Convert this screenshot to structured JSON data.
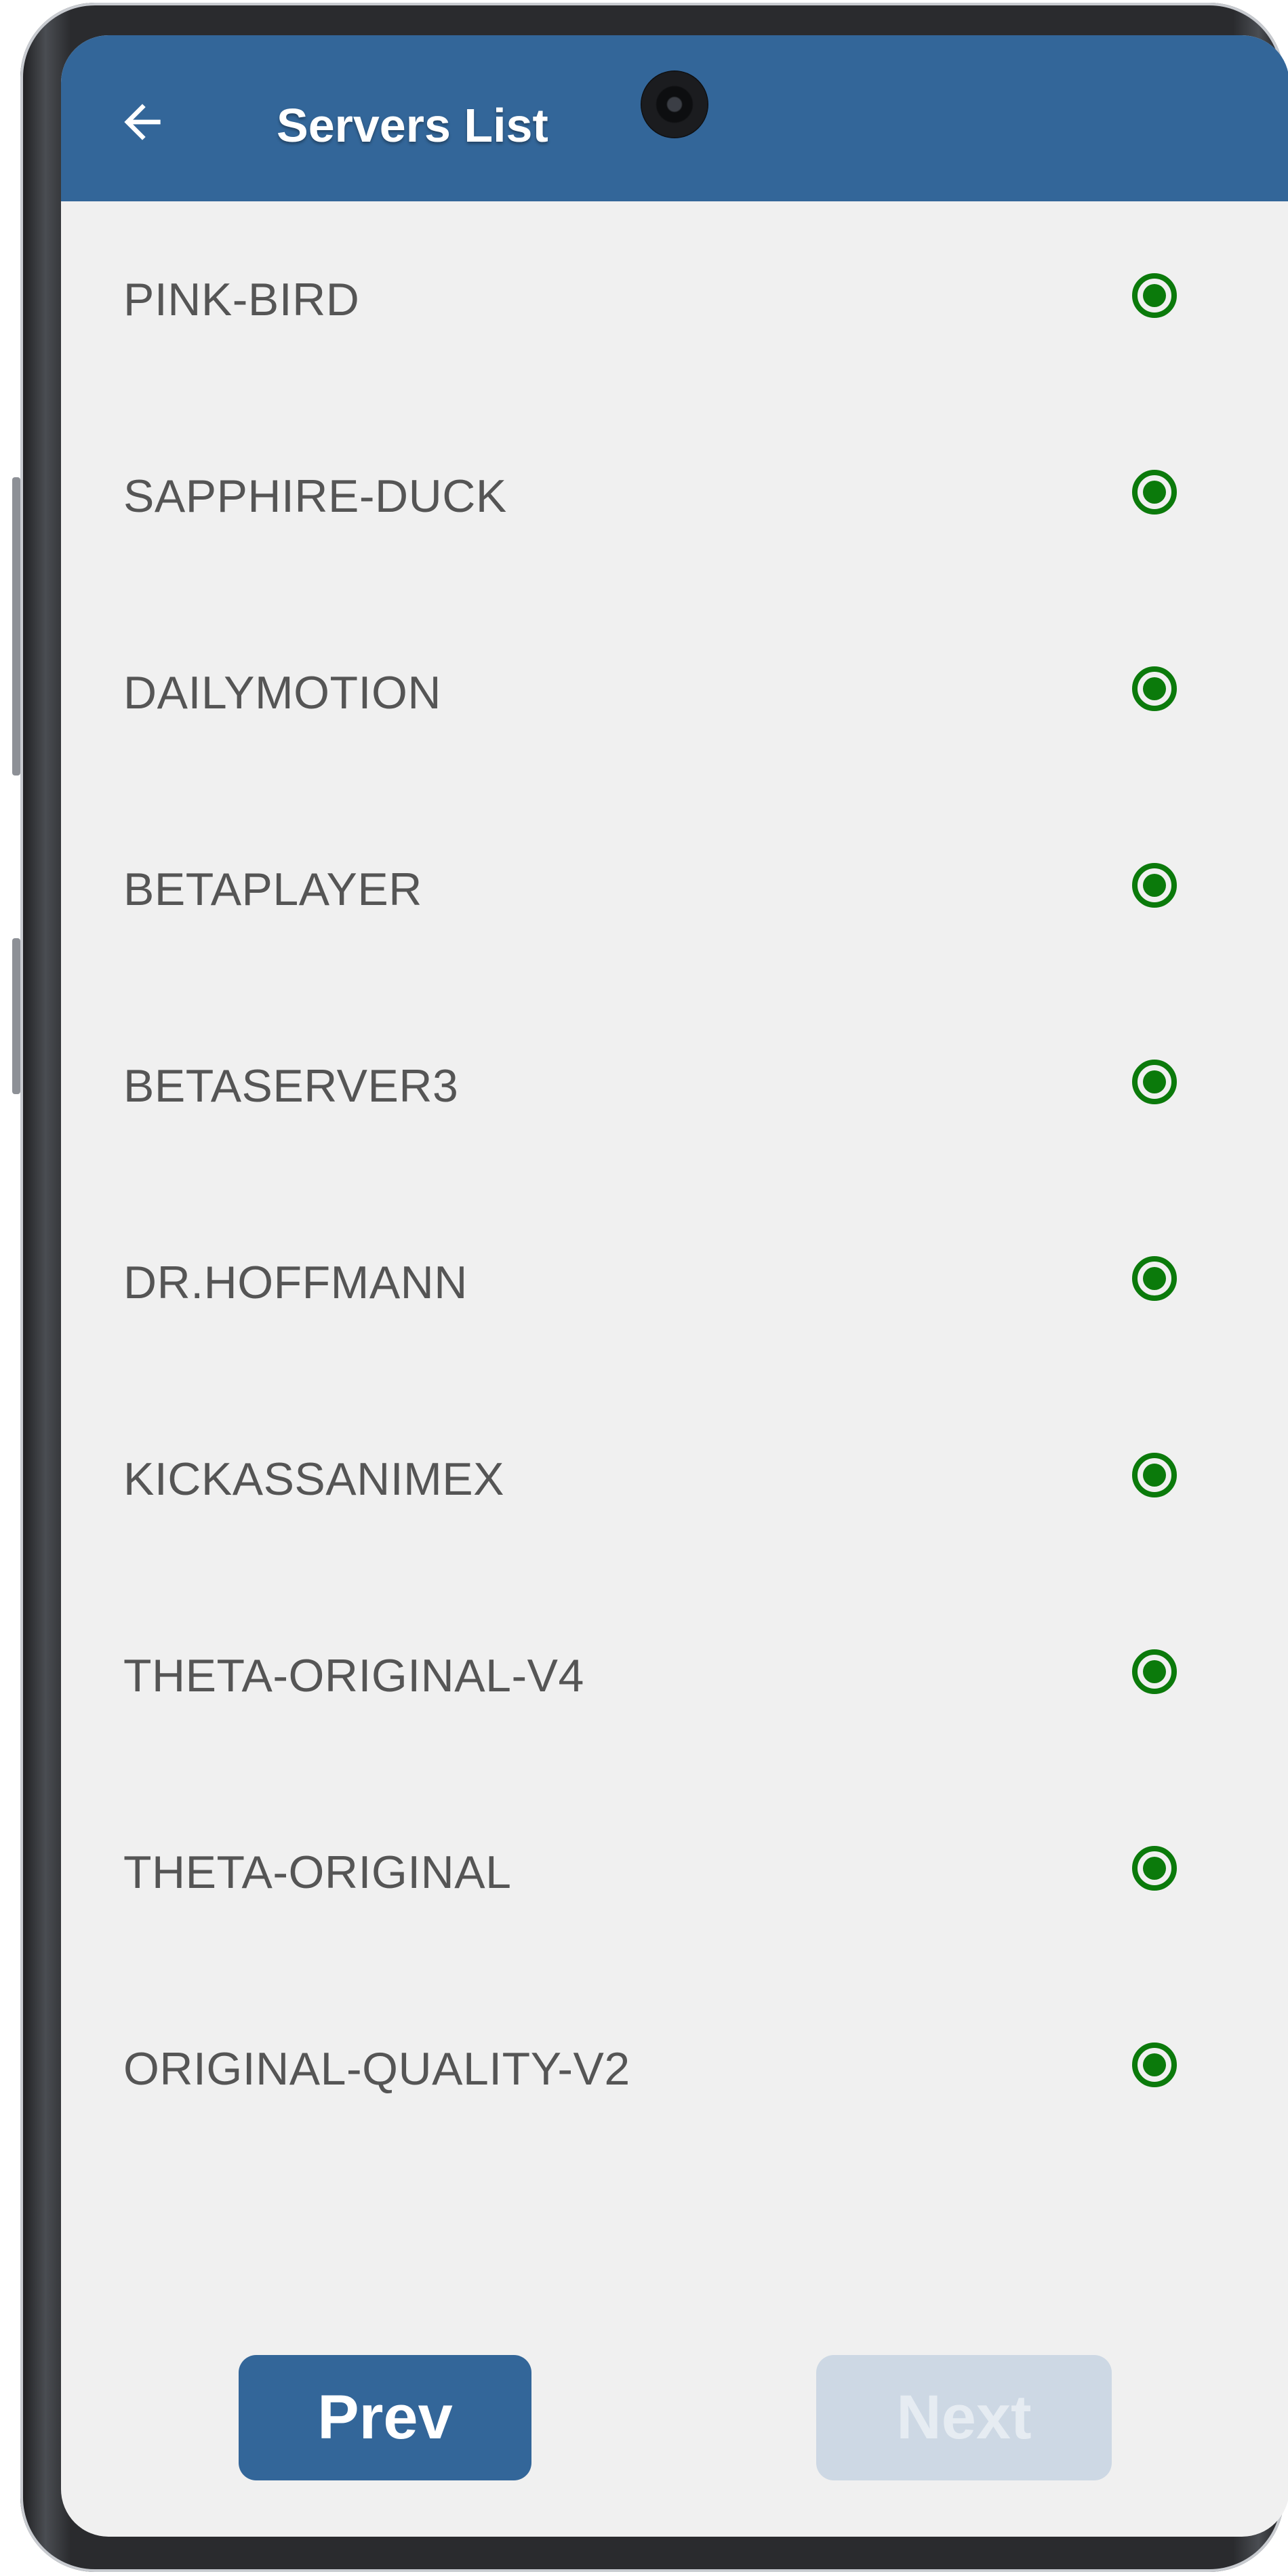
{
  "appbar": {
    "title": "Servers List",
    "back_icon": "arrow-left-icon",
    "color": "#336699"
  },
  "servers": [
    {
      "label": "PINK-BIRD",
      "selected": true
    },
    {
      "label": "SAPPHIRE-DUCK",
      "selected": true
    },
    {
      "label": "DAILYMOTION",
      "selected": true
    },
    {
      "label": "BETAPLAYER",
      "selected": true
    },
    {
      "label": "BETASERVER3",
      "selected": true
    },
    {
      "label": "DR.HOFFMANN",
      "selected": true
    },
    {
      "label": "KICKASSANIMEX",
      "selected": true
    },
    {
      "label": "THETA-ORIGINAL-V4",
      "selected": true
    },
    {
      "label": "THETA-ORIGINAL",
      "selected": true
    },
    {
      "label": "ORIGINAL-QUALITY-V2",
      "selected": true
    }
  ],
  "status_color": "#0b7a0b",
  "pagination": {
    "prev_label": "Prev",
    "next_label": "Next",
    "next_enabled": false
  }
}
